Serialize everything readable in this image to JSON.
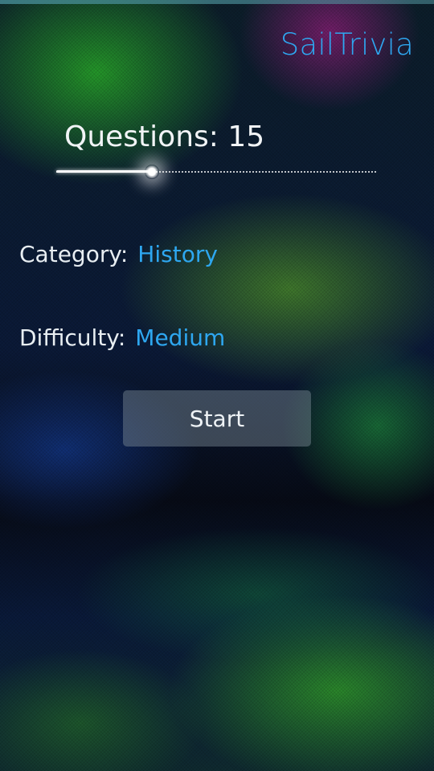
{
  "app": {
    "title": "SailTrivia"
  },
  "questions_slider": {
    "label": "Questions: 15",
    "value": 15,
    "fill_fraction": 0.3
  },
  "category": {
    "label": "Category:",
    "value": "History"
  },
  "difficulty": {
    "label": "Difficulty:",
    "value": "Medium"
  },
  "start_button": {
    "label": "Start"
  },
  "colors": {
    "accent": "#2ea7f0",
    "text": "#f1f4f6"
  }
}
